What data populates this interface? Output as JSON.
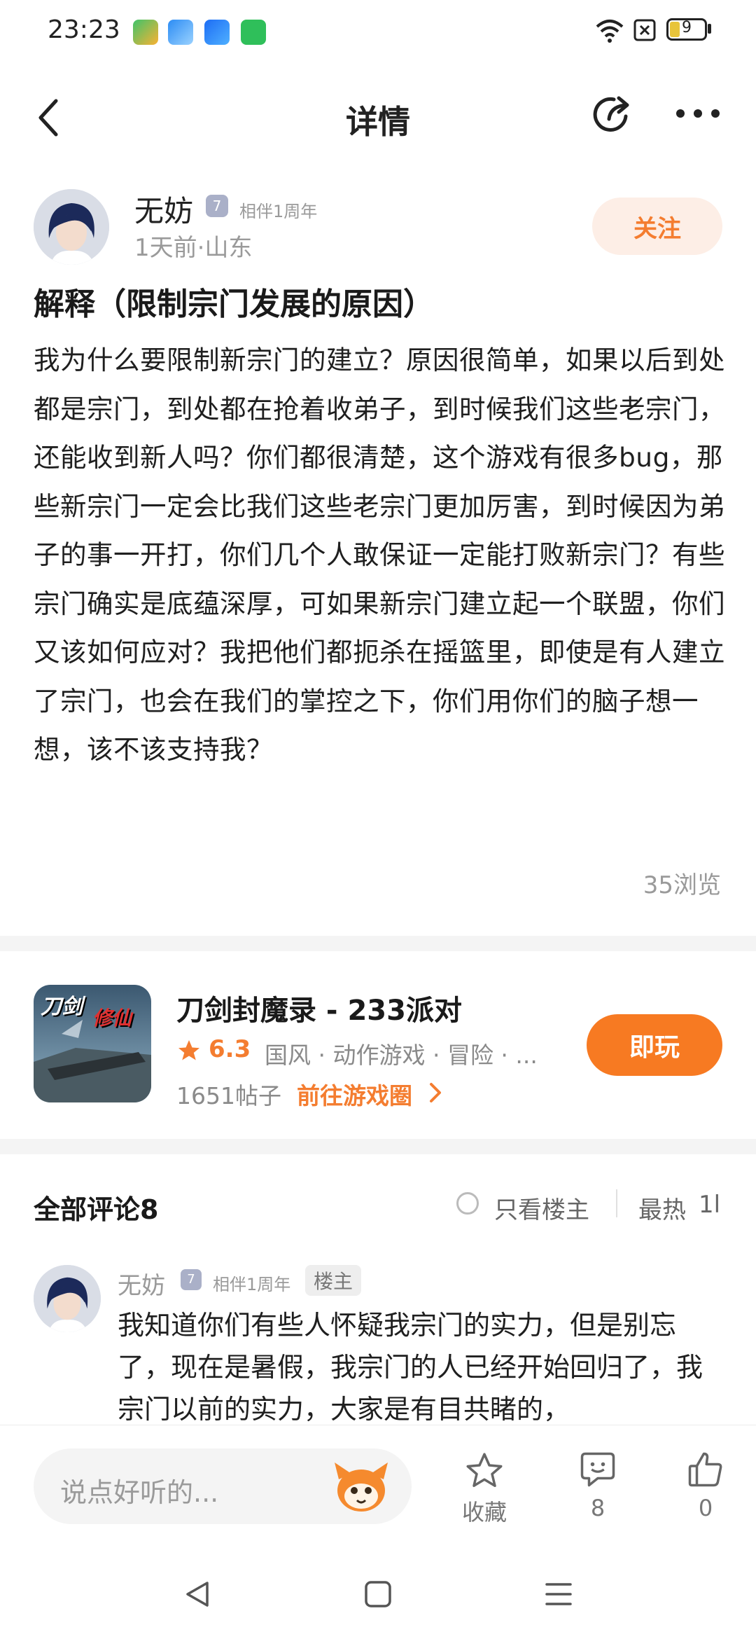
{
  "status_bar": {
    "time": "23:23",
    "battery": "9"
  },
  "nav": {
    "title": "详情"
  },
  "author": {
    "name": "无妨",
    "badge": "相伴1周年",
    "meta": "1天前·山东",
    "follow_label": "关注"
  },
  "post": {
    "title": "解释（限制宗门发展的原因）",
    "body": "我为什么要限制新宗门的建立？原因很简单，如果以后到处都是宗门，到处都在抢着收弟子，到时候我们这些老宗门，还能收到新人吗？你们都很清楚，这个游戏有很多bug，那些新宗门一定会比我们这些老宗门更加厉害，到时候因为弟子的事一开打，你们几个人敢保证一定能打败新宗门？有些宗门确实是底蕴深厚，可如果新宗门建立起一个联盟，你们又该如何应对？我把他们都扼杀在摇篮里，即使是有人建立了宗门，也会在我们的掌控之下，你们用你们的脑子想一想，该不该支持我？",
    "views": "35浏览"
  },
  "game": {
    "thumb_text_1": "刀剑",
    "thumb_text_2": "修仙",
    "title": "刀剑封魔录 - 233派对",
    "rating": "6.3",
    "tags": "国风 · 动作游戏 · 冒险 · ...",
    "posts": "1651帖子",
    "goto": "前往游戏圈",
    "play_label": "即玩"
  },
  "comments_header": {
    "title": "全部评论8",
    "only_host": "只看楼主",
    "sort": "最热",
    "sort_icon_text": "1l"
  },
  "comment": {
    "name": "无妨",
    "badge": "相伴1周年",
    "host_tag": "楼主",
    "body": "我知道你们有些人怀疑我宗门的实力，但是别忘了，现在是暑假，我宗门的人已经开始回归了，我宗门以前的实力，大家是有目共睹的，"
  },
  "bottom_bar": {
    "placeholder": "说点好听的...",
    "collect_label": "收藏",
    "comment_count": "8",
    "like_count": "0"
  },
  "colors": {
    "accent": "#f77a22",
    "follow_bg": "#fdeee6",
    "text": "#1a1a1a",
    "muted": "#9a9a9a"
  }
}
